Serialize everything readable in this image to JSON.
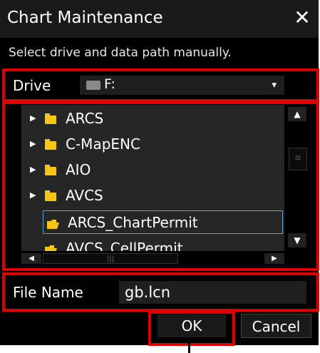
{
  "dialog": {
    "title": "Chart Maintenance",
    "close_glyph": "✕",
    "instruction": "Select drive and data path manually."
  },
  "drive": {
    "label": "Drive",
    "value": "F:",
    "icon": "drive-icon",
    "dropdown_glyph": "▾"
  },
  "tree": {
    "items": [
      {
        "label": "ARCS",
        "expanded": false
      },
      {
        "label": "C-MapENC",
        "expanded": false
      },
      {
        "label": "AIO",
        "expanded": false
      },
      {
        "label": "AVCS",
        "expanded": false
      },
      {
        "label": "ARCS_ChartPermit",
        "selected": true
      },
      {
        "label": "AVCS_CellPermit"
      }
    ],
    "selection_color": "#5a9fd6",
    "folder_color": "#f5c518"
  },
  "file": {
    "label": "File Name",
    "value": "gb.lcn"
  },
  "buttons": {
    "ok": "OK",
    "cancel": "Cancel"
  },
  "highlight_color": "#e00000"
}
